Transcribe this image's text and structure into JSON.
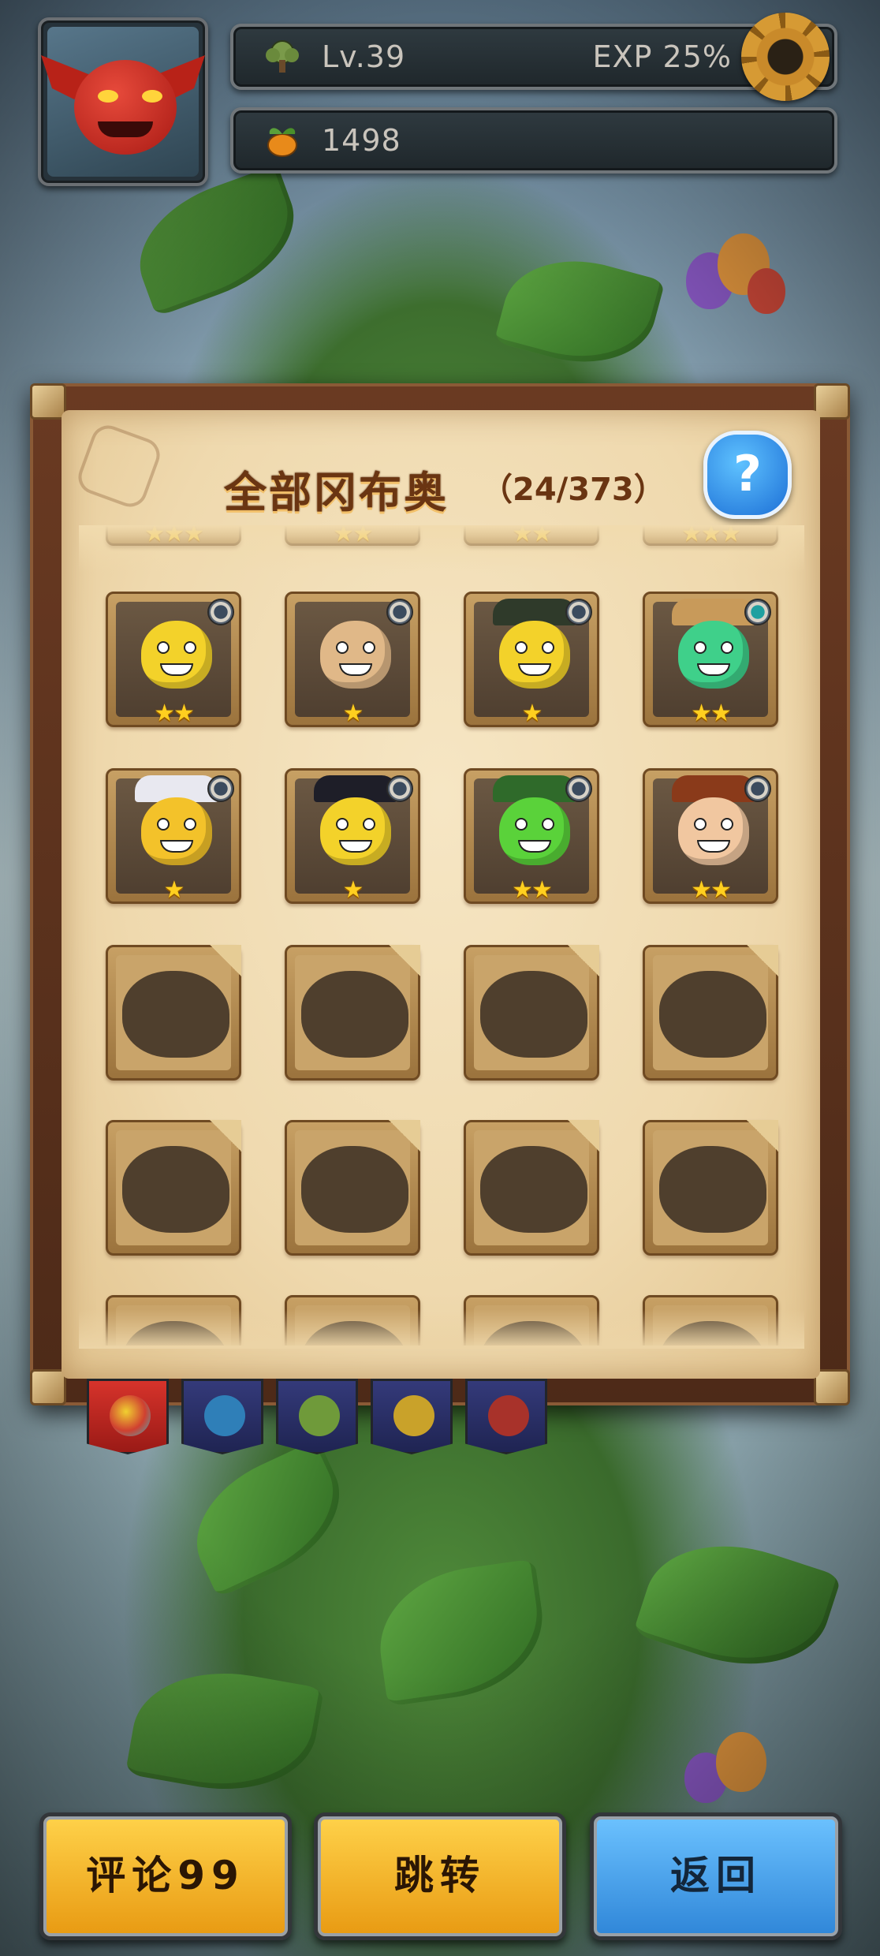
{
  "header": {
    "level": "Lv.39",
    "exp": "EXP 25%",
    "coins": "1498"
  },
  "panel": {
    "title": "全部冈布奥",
    "count": "（24/373）",
    "help_label": "?"
  },
  "grid": {
    "partial_row": [
      {
        "stars": "★★★"
      },
      {
        "stars": "★★"
      },
      {
        "stars": "★★"
      },
      {
        "stars": "★★★"
      }
    ],
    "row1": [
      {
        "stars": "★★",
        "color": "#f3d22a"
      },
      {
        "stars": "★",
        "color": "#e0b888"
      },
      {
        "stars": "★",
        "color": "#f3d22a"
      },
      {
        "stars": "★★",
        "color": "#3fd08a"
      }
    ],
    "row2": [
      {
        "stars": "★",
        "color": "#f3c22a"
      },
      {
        "stars": "★",
        "color": "#f3d22a"
      },
      {
        "stars": "★★",
        "color": "#5ad23a"
      },
      {
        "stars": "★★",
        "color": "#f1c7a0"
      }
    ]
  },
  "tabs": [
    {
      "name": "all",
      "color": "#b9241f"
    },
    {
      "name": "blue",
      "color": "#2a2f6a"
    },
    {
      "name": "green",
      "color": "#2a2f6a"
    },
    {
      "name": "yellow",
      "color": "#2a2f6a"
    },
    {
      "name": "red",
      "color": "#2a2f6a"
    }
  ],
  "buttons": {
    "comment": "评论99",
    "jump": "跳转",
    "back": "返回"
  },
  "icons": {
    "settings": "gear-icon",
    "help": "question-icon",
    "level": "tree-icon",
    "coins": "fruit-icon"
  }
}
